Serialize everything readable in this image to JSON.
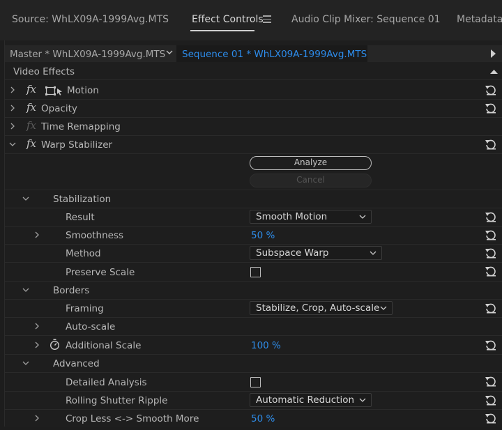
{
  "tabs": {
    "source": "Source: WhLX09A-1999Avg.MTS",
    "effect_controls": "Effect Controls",
    "audio_mixer": "Audio Clip Mixer: Sequence 01",
    "metadata": "Metadata"
  },
  "sequence_bar": {
    "master": "Master * WhLX09A-1999Avg.MTS",
    "active_sequence": "Sequence 01 * WhLX09A-1999Avg.MTS"
  },
  "section": {
    "title": "Video Effects"
  },
  "effects": {
    "motion": "Motion",
    "opacity": "Opacity",
    "time_remapping": "Time Remapping",
    "warp_stabilizer": "Warp Stabilizer",
    "fx_symbol": "fx"
  },
  "warp": {
    "analyze": "Analyze",
    "cancel": "Cancel",
    "stabilization": "Stabilization",
    "result_label": "Result",
    "result_value": "Smooth Motion",
    "smoothness_label": "Smoothness",
    "smoothness_value": "50 %",
    "method_label": "Method",
    "method_value": "Subspace Warp",
    "preserve_scale_label": "Preserve Scale",
    "borders": "Borders",
    "framing_label": "Framing",
    "framing_value": "Stabilize, Crop, Auto-scale",
    "auto_scale_label": "Auto-scale",
    "additional_scale_label": "Additional Scale",
    "additional_scale_value": "100 %",
    "advanced": "Advanced",
    "detailed_analysis_label": "Detailed Analysis",
    "rolling_shutter_label": "Rolling Shutter Ripple",
    "rolling_shutter_value": "Automatic Reduction",
    "crop_label": "Crop Less <-> Smooth More",
    "crop_value": "50 %"
  },
  "colors": {
    "accent_blue": "#2e8ce8",
    "panel_bg": "#1e1e1e"
  },
  "icons": [
    "hamburger-menu-icon",
    "chevron-down-icon",
    "play-triangle-icon",
    "chevron-right-icon",
    "fx-icon",
    "transform-icon",
    "reset-icon",
    "stopwatch-icon",
    "collapse-up-icon"
  ]
}
